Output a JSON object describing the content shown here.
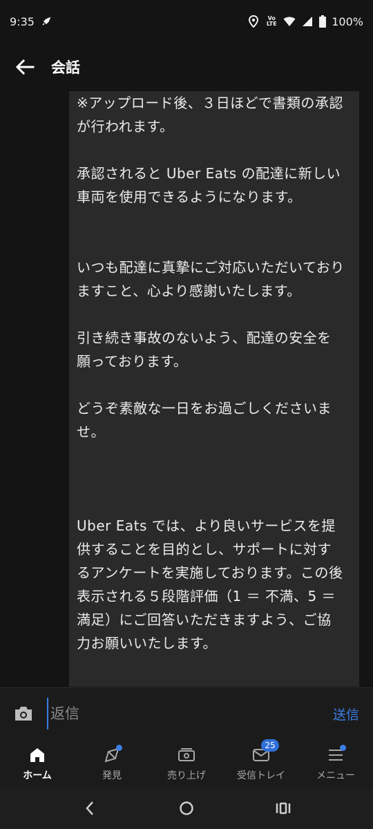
{
  "status_bar": {
    "time": "9:35",
    "battery": "100%",
    "volte_line1": "Vo",
    "volte_line2": "LTE"
  },
  "app_bar": {
    "title": "会話"
  },
  "message": {
    "paragraphs": [
      "※アップロード後、３日ほどで書類の承認が行われます。",
      "承認されると Uber Eats の配達に新しい車両を使用できるようになります。",
      "いつも配達に真摯にご対応いただいておりますこと、心より感謝いたします。",
      "引き続き事故のないよう、配達の安全を願っております。",
      "どうぞ素敵な一日をお過ごしくださいませ。",
      "Uber Eats では、より良いサービスを提供することを目的とし、サポートに対するアンケートを実施しております。この後表示される５段階評価（1 ＝ 不満、5 ＝ 満足）にご回答いただきますよう、ご協力お願いいたします。"
    ]
  },
  "reply_bar": {
    "placeholder": "返信",
    "send_label": "送信"
  },
  "bottom_nav": {
    "items": [
      {
        "label": "ホーム",
        "icon": "home-icon"
      },
      {
        "label": "発見",
        "icon": "discover-icon"
      },
      {
        "label": "売り上げ",
        "icon": "earnings-icon"
      },
      {
        "label": "受信トレイ",
        "icon": "inbox-icon",
        "badge": "25"
      },
      {
        "label": "メニュー",
        "icon": "menu-icon"
      }
    ]
  },
  "colors": {
    "accent": "#3b7fe6",
    "background": "#141414",
    "bubble": "#2a2a2a"
  }
}
